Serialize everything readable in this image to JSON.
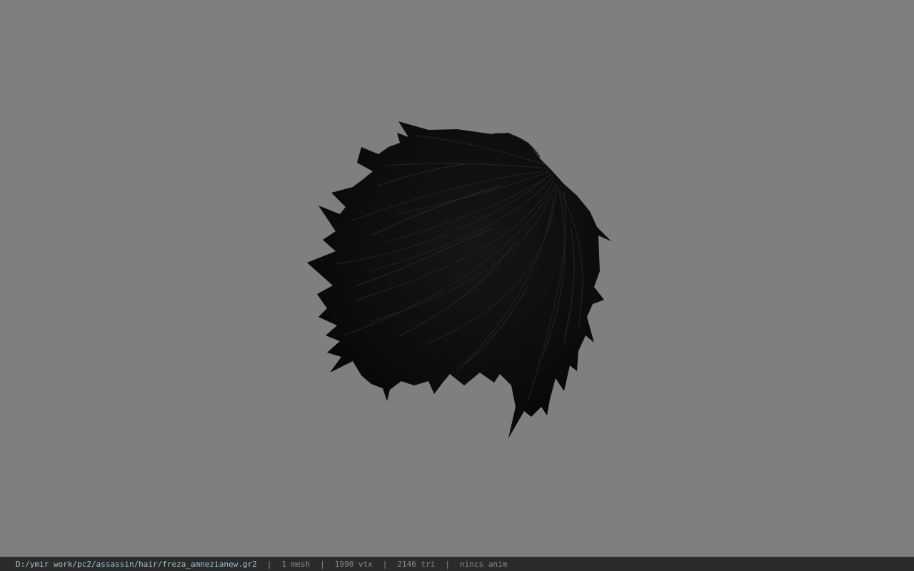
{
  "viewport": {
    "background_color": "#7f7f7f",
    "model": {
      "kind": "hair-mesh",
      "fill_color": "#0d0d0d",
      "strand_color": "#1e1e1e"
    }
  },
  "statusbar": {
    "file_path": "D:/ymir work/pc2/assassin/hair/freza_amnezianew.gr2",
    "separator": "|",
    "mesh_count": "1 mesh",
    "vertex_count": "1990 vtx",
    "triangle_count": "2146 tri",
    "anim_status": "nincs anim",
    "colors": {
      "background": "#2b2b2b",
      "path": "#9ec3d6",
      "text": "#8a8a8a"
    }
  }
}
